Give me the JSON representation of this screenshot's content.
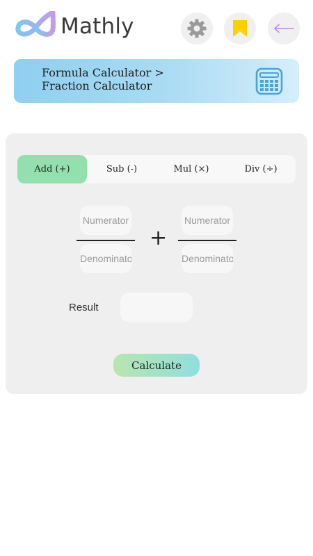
{
  "app": {
    "name": "Mathly"
  },
  "icons": {
    "logo": "infinity-logo-icon",
    "settings": "gear-icon",
    "bookmark": "bookmark-icon",
    "back": "back-arrow-icon",
    "calculator": "calculator-icon"
  },
  "colors": {
    "accent": "#92e0ad",
    "bookmark": "#ffd000",
    "back_arrow": "#b48ee6",
    "banner_start": "#8fcff0",
    "banner_end": "#d6eefa",
    "calc_icon": "#4aa3d8"
  },
  "breadcrumb": {
    "line1": "Formula Calculator >",
    "line2": "Fraction Calculator"
  },
  "tabs": [
    {
      "label": "Add (+)",
      "active": true
    },
    {
      "label": "Sub (-)",
      "active": false
    },
    {
      "label": "Mul (×)",
      "active": false
    },
    {
      "label": "Div (÷)",
      "active": false
    }
  ],
  "fraction": {
    "operator": "+",
    "numerator_placeholder": "Numerator",
    "denominator_placeholder": "Denominator"
  },
  "result": {
    "label": "Result",
    "value": ""
  },
  "calculate_label": "Calculate"
}
